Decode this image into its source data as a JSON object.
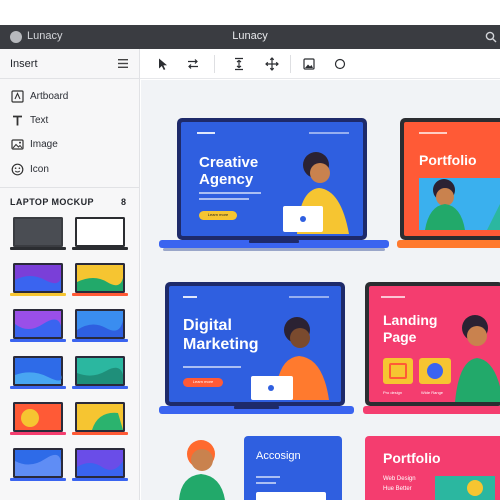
{
  "window": {
    "app_name": "Lunacy",
    "title": "Lunacy"
  },
  "panel": {
    "header": "Insert",
    "insert_items": [
      {
        "label": "Artboard",
        "icon": "artboard-icon"
      },
      {
        "label": "Text",
        "icon": "text-icon"
      },
      {
        "label": "Image",
        "icon": "image-icon"
      },
      {
        "label": "Icon",
        "icon": "smiley-icon"
      }
    ],
    "section_title": "LAPTOP MOCKUP",
    "section_count": "8"
  },
  "toolbar": {
    "tools": [
      "pointer-icon",
      "swap-icon",
      "align-vertical-icon",
      "move-icon",
      "image-tool-icon",
      "circle-icon"
    ]
  },
  "canvas": {
    "mockups": [
      {
        "title_line1": "Creative",
        "title_line2": "Agency",
        "button": "Learn more"
      },
      {
        "title_line1": "Portfolio"
      },
      {
        "title_line1": "Digital",
        "title_line2": "Marketing",
        "button": "Learn more"
      },
      {
        "title_line1": "Landing",
        "title_line2": "Page",
        "caption1": "Pro design",
        "caption2": "Wide Range"
      },
      {
        "title_line1": "Accosign"
      },
      {
        "title_line1": "Portfolio",
        "sub1": "Web Design",
        "sub2": "Hue Better"
      }
    ]
  },
  "colors": {
    "blue": "#2f5fe0",
    "orange": "#ff5a36",
    "pink": "#f43d6f",
    "yellow": "#f6c531",
    "dark": "#3a3c41"
  }
}
